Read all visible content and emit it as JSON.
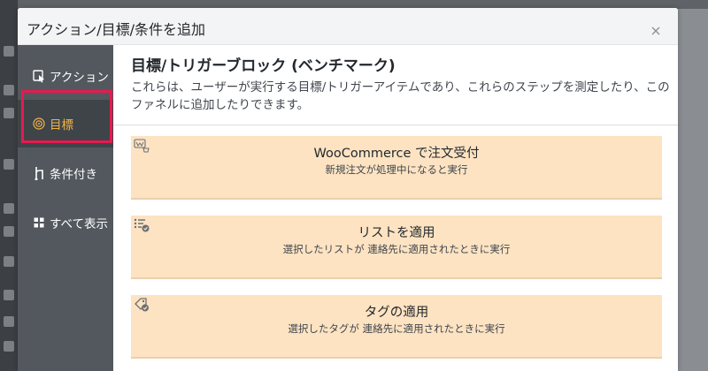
{
  "modal": {
    "title": "アクション/目標/条件を追加"
  },
  "nav": {
    "items": [
      {
        "label": "アクション",
        "icon": "action-icon"
      },
      {
        "label": "目標",
        "icon": "goal-icon",
        "active": true
      },
      {
        "label": "条件付き",
        "icon": "conditional-icon"
      },
      {
        "label": "すべて表示",
        "icon": "grid-icon"
      }
    ]
  },
  "content": {
    "title": "目標/トリガーブロック (ベンチマーク)",
    "description": "これらは、ユーザーが実行する目標/トリガーアイテムであり、これらのステップを測定したり、このファネルに追加したりできます。",
    "cards": [
      {
        "title": "WooCommerce で注文受付",
        "desc": "新規注文が処理中になると実行",
        "icon": "woocommerce-icon"
      },
      {
        "title": "リストを適用",
        "desc": "選択したリストが 連絡先に適用されたときに実行",
        "icon": "list-check-icon"
      },
      {
        "title": "タグの適用",
        "desc": "選択したタグが 連絡先に適用されたときに実行",
        "icon": "tag-check-icon"
      }
    ]
  },
  "colors": {
    "nav_bg": "#52585e",
    "nav_active_bg": "#3f4449",
    "nav_active_text": "#f0b449",
    "highlight": "#e8194f",
    "card_bg": "#fde3c2"
  }
}
